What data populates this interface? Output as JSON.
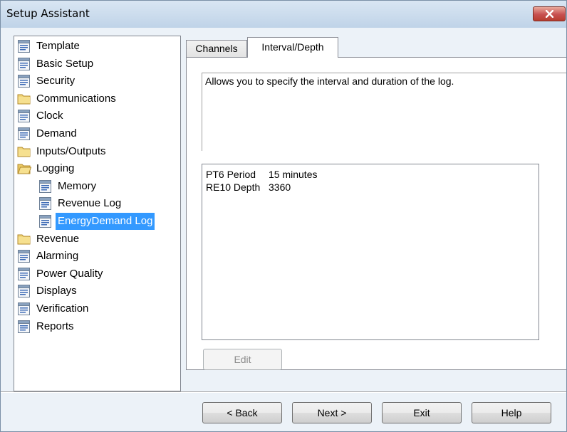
{
  "window": {
    "title": "Setup Assistant"
  },
  "tree": {
    "items": [
      {
        "label": "Template",
        "icon": "page-icon"
      },
      {
        "label": "Basic Setup",
        "icon": "page-icon"
      },
      {
        "label": "Security",
        "icon": "page-icon"
      },
      {
        "label": "Communications",
        "icon": "folder-icon"
      },
      {
        "label": "Clock",
        "icon": "page-icon"
      },
      {
        "label": "Demand",
        "icon": "page-icon"
      },
      {
        "label": "Inputs/Outputs",
        "icon": "folder-icon"
      },
      {
        "label": "Logging",
        "icon": "folder-open-icon"
      },
      {
        "label": "Memory",
        "icon": "page-icon"
      },
      {
        "label": "Revenue Log",
        "icon": "page-icon"
      },
      {
        "label": "EnergyDemand Log",
        "icon": "page-icon",
        "selected": true
      },
      {
        "label": "Revenue",
        "icon": "folder-icon"
      },
      {
        "label": "Alarming",
        "icon": "page-icon"
      },
      {
        "label": "Power Quality",
        "icon": "page-icon"
      },
      {
        "label": "Displays",
        "icon": "page-icon"
      },
      {
        "label": "Verification",
        "icon": "page-icon"
      },
      {
        "label": "Reports",
        "icon": "page-icon"
      }
    ]
  },
  "tabs": [
    {
      "label": "Channels",
      "active": false
    },
    {
      "label": "Interval/Depth",
      "active": true
    }
  ],
  "panel": {
    "description": "Allows you to specify the interval and duration of the log.",
    "rows": [
      {
        "name": "PT6 Period",
        "value": "15 minutes"
      },
      {
        "name": "RE10 Depth",
        "value": "3360"
      }
    ],
    "edit_label": "Edit"
  },
  "buttons": {
    "back": "< Back",
    "next": "Next >",
    "exit": "Exit",
    "help": "Help"
  },
  "colors": {
    "selection": "#3399ff",
    "close_button": "#c75050",
    "window_bg": "#ecf2f8"
  }
}
